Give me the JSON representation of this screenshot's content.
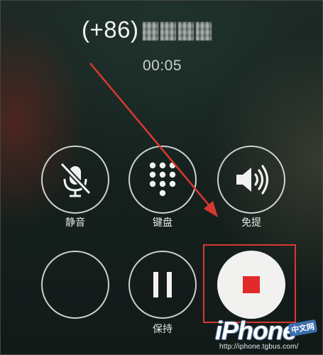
{
  "caller": {
    "country_code": "(+86)",
    "number_state": "pixelated"
  },
  "call": {
    "timer": "00:05"
  },
  "controls": {
    "row1": [
      {
        "label": "静音",
        "icon": "mute-microphone-icon"
      },
      {
        "label": "键盘",
        "icon": "keypad-icon"
      },
      {
        "label": "免提",
        "icon": "speaker-icon"
      }
    ],
    "row2": [
      {
        "label": "",
        "icon": "blank"
      },
      {
        "label": "保持",
        "icon": "pause-icon"
      },
      {
        "label": "",
        "icon": "stop-record-icon"
      }
    ]
  },
  "annotation": {
    "color": "#d8392f"
  },
  "watermark": {
    "brand": "iPhone",
    "tag": "中文网",
    "url": "http://iphone.tgbus.com/"
  },
  "colors": {
    "record_square": "#e12a2a",
    "button_ring": "#ebf0ec"
  }
}
